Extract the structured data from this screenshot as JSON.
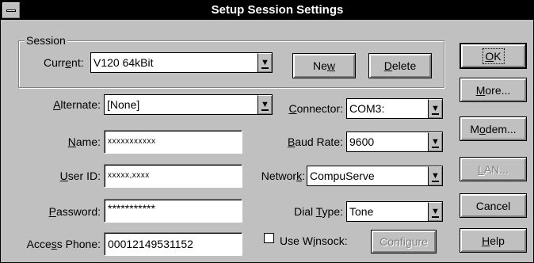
{
  "window": {
    "title": "Setup Session Settings"
  },
  "session": {
    "group_label": "Session",
    "current": {
      "label_pre": "Curr",
      "label_u": "e",
      "label_post": "nt:",
      "value": "V120 64kBit"
    },
    "new_btn": {
      "pre": "Ne",
      "u": "w",
      "post": ""
    },
    "delete_btn": {
      "pre": "",
      "u": "D",
      "post": "elete"
    }
  },
  "fields": {
    "alternate": {
      "label_u": "A",
      "label_post": "lternate:",
      "value": "[None]"
    },
    "name": {
      "label_u": "N",
      "label_post": "ame:",
      "value": "xxxxxxxxxxx"
    },
    "user_id": {
      "label_u": "U",
      "label_post": "ser ID:",
      "value": "xxxxx,xxxx"
    },
    "password": {
      "label_u": "P",
      "label_post": "assword:",
      "value": "***********"
    },
    "access_phone": {
      "label_pre": "Acce",
      "label_u": "s",
      "label_post": "s Phone:",
      "value": "00012149531152"
    },
    "connector": {
      "label_u": "C",
      "label_post": "onnector:",
      "value": "COM3:"
    },
    "baud_rate": {
      "label_u": "B",
      "label_post": "aud Rate:",
      "value": "9600"
    },
    "network": {
      "label_pre": "Networ",
      "label_u": "k",
      "label_post": ":",
      "value": "CompuServe"
    },
    "dial_type": {
      "label_pre": "Dial ",
      "label_u": "T",
      "label_post": "ype:",
      "value": "Tone"
    }
  },
  "winsock": {
    "label_pre": "Use W",
    "label_u": "i",
    "label_post": "nsock:",
    "checked": false,
    "configure": "Configure"
  },
  "side_buttons": {
    "ok": {
      "pre": "",
      "u": "O",
      "post": "K"
    },
    "more": {
      "pre": "",
      "u": "M",
      "post": "ore..."
    },
    "modem": {
      "pre": "M",
      "u": "o",
      "post": "dem..."
    },
    "lan": {
      "pre": "",
      "u": "L",
      "post": "AN..."
    },
    "cancel": {
      "pre": "Cancel",
      "u": "",
      "post": ""
    },
    "help": {
      "pre": "",
      "u": "H",
      "post": "elp"
    }
  }
}
